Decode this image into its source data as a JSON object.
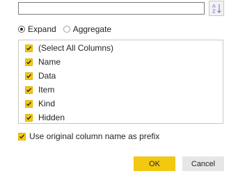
{
  "search": {
    "value": "",
    "placeholder": ""
  },
  "sort": {
    "icon": "sort-az-icon",
    "glyph_top": "A",
    "glyph_bottom": "Z"
  },
  "mode": {
    "expand_label": "Expand",
    "aggregate_label": "Aggregate",
    "selected": "Expand"
  },
  "columns": [
    {
      "label": "(Select All Columns)",
      "checked": true
    },
    {
      "label": "Name",
      "checked": true
    },
    {
      "label": "Data",
      "checked": true
    },
    {
      "label": "Item",
      "checked": true
    },
    {
      "label": "Kind",
      "checked": true
    },
    {
      "label": "Hidden",
      "checked": true
    }
  ],
  "prefix": {
    "label": "Use original column name as prefix",
    "checked": true
  },
  "buttons": {
    "ok_label": "OK",
    "cancel_label": "Cancel"
  },
  "colors": {
    "accent": "#F2C811",
    "cancel_bg": "#E6E6E6",
    "sort_icon": "#6B69D6"
  }
}
